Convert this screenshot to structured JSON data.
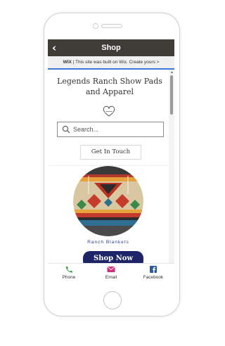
{
  "topbar": {
    "title": "Shop",
    "back_icon": "chevron-left-icon"
  },
  "wix_banner": {
    "logo": "WIX",
    "text": "| This site was built on Wix. Create yours >"
  },
  "site": {
    "title": "Legends Ranch Show Pads and Apparel"
  },
  "search": {
    "placeholder": "Search..."
  },
  "contact": {
    "label": "Get In Touch"
  },
  "product": {
    "caption": "Ranch Blankets",
    "button_label": "Shop Now"
  },
  "bottom_nav": [
    {
      "label": "Phone",
      "icon": "phone-icon",
      "color": "#3aa04a"
    },
    {
      "label": "Email",
      "icon": "email-icon",
      "color": "#d1307a"
    },
    {
      "label": "Facebook",
      "icon": "facebook-icon",
      "color": "#2d5b9a"
    }
  ],
  "colors": {
    "header_bg": "#3f3b37",
    "wix_bar_accent": "#3b78d8",
    "button_navy": "#1d2468",
    "caption_blue": "#2b3a8c"
  }
}
